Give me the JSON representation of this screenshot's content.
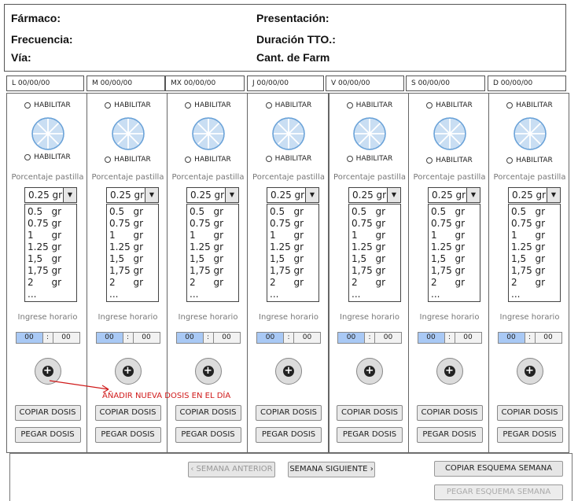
{
  "header": {
    "farmaco": "Fármaco:",
    "presentacion": "Presentación:",
    "frecuencia": "Frecuencia:",
    "duracion": "Duración TTO.:",
    "via": "Vía:",
    "cantidad": "Cant. de Farm"
  },
  "days": [
    {
      "label": "L 00/00/00"
    },
    {
      "label": "M 00/00/00"
    },
    {
      "label": "MX 00/00/00"
    },
    {
      "label": "J 00/00/00"
    },
    {
      "label": "V 00/00/00"
    },
    {
      "label": "S 00/00/00"
    },
    {
      "label": "D 00/00/00"
    }
  ],
  "column": {
    "habilitar": "HABILITAR",
    "porcentaje": "Porcentaje pastilla",
    "selected": "0.25 gr",
    "options": [
      "0.5   gr",
      "0.75 gr",
      "1      gr",
      "1.25 gr",
      "1,5   gr",
      "1,75 gr",
      "2      gr",
      "..."
    ],
    "ingrese": "Ingrese horario",
    "hour": "00",
    "sep": ":",
    "minute": "00",
    "copiar": "COPIAR DOSIS",
    "pegar": "PEGAR DOSIS",
    "add_icon": "plus-circle-icon",
    "pill_icon": "pill-icon"
  },
  "annotation": "AÑADIR NUEVA DOSIS EN EL DÍA",
  "footer": {
    "prev": "SEMANA ANTERIOR",
    "next": "SEMANA SIGUIENTE",
    "copy_schema": "COPIAR ESQUEMA SEMANA",
    "paste_schema": "PEGAR ESQUEMA SEMANA"
  },
  "colors": {
    "time_highlight": "#a9c9f5",
    "pill_fill": "#c9def3",
    "pill_stroke": "#6aa2d8",
    "annotation": "#d01a1a"
  }
}
